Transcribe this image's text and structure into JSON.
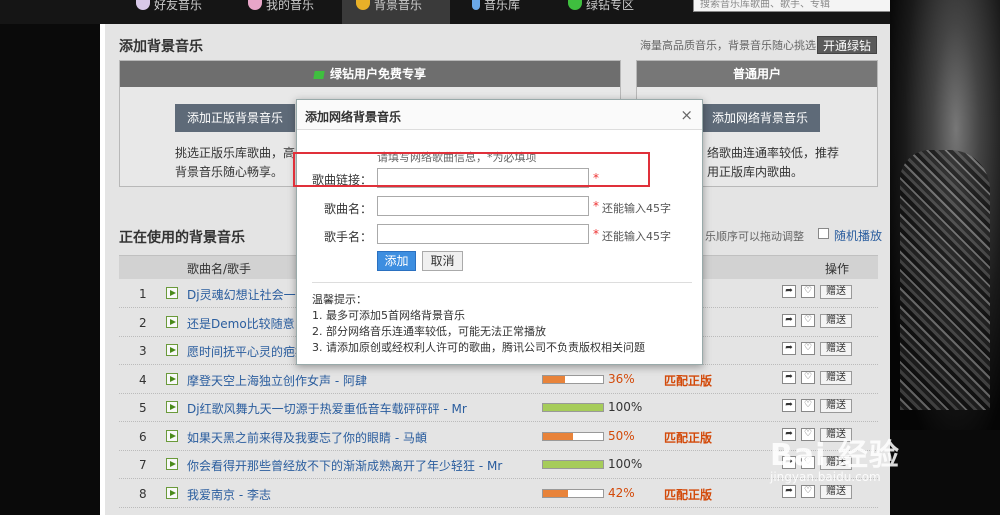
{
  "nav": {
    "items": [
      {
        "label": "好友音乐",
        "icon": "user-icon"
      },
      {
        "label": "我的音乐",
        "icon": "user-icon"
      },
      {
        "label": "背景音乐",
        "icon": "star-icon"
      },
      {
        "label": "音乐库",
        "icon": "note-icon"
      },
      {
        "label": "绿钻专区",
        "icon": "gem-icon"
      }
    ],
    "search_placeholder": "搜索音乐库歌曲、歌手、专辑"
  },
  "add_section": {
    "title": "添加背景音乐",
    "hint": "海量高品质音乐，背景音乐随心挑选",
    "open_button": "开通绿钻",
    "vip_box": {
      "title": "绿钻用户免费专享",
      "button": "添加正版背景音乐",
      "text": "挑选正版乐库歌曲，高品",
      "text2": "背景音乐随心畅享。"
    },
    "normal_box": {
      "title": "普通用户",
      "button": "添加网络背景音乐",
      "text": "络歌曲连通率较低，推荐",
      "text2": "用正版库内歌曲。"
    }
  },
  "using_section": {
    "title": "正在使用的背景音乐",
    "drag_hint": "乐顺序可以拖动调整",
    "random_label": "随机播放",
    "col_song": "歌曲名/歌手",
    "col_action": "操作",
    "send_label": "赠送",
    "rows": [
      {
        "num": "1",
        "name": "Dj灵魂幻想让社会一次",
        "pct": "",
        "match": "",
        "fill": 0,
        "color": "#8cc152"
      },
      {
        "num": "2",
        "name": "还是Demo比较随意 - 先",
        "pct": "",
        "match": "",
        "fill": 0,
        "color": "#8cc152"
      },
      {
        "num": "3",
        "name": "愿时间抚平心灵的疤痕",
        "pct": "",
        "match": "",
        "fill": 0,
        "color": "#8cc152"
      },
      {
        "num": "4",
        "name": "摩登天空上海独立创作女声 - 阿肆",
        "pct": "36%",
        "match": "匹配正版",
        "fill": 0.36,
        "color": "#e8833a"
      },
      {
        "num": "5",
        "name": "Dj红歌风舞九天一切源于热爱重低音车载砰砰砰 - Mr",
        "pct": "100%",
        "match": "",
        "fill": 1,
        "color": "#a6cc5a"
      },
      {
        "num": "6",
        "name": "如果天黑之前来得及我要忘了你的眼睛 - 马頔",
        "pct": "50%",
        "match": "匹配正版",
        "fill": 0.5,
        "color": "#e8833a"
      },
      {
        "num": "7",
        "name": "你会看得开那些曾经放不下的渐渐成熟离开了年少轻狂 - Mr",
        "pct": "100%",
        "match": "",
        "fill": 1,
        "color": "#a6cc5a"
      },
      {
        "num": "8",
        "name": "我爱南京 - 李志",
        "pct": "42%",
        "match": "匹配正版",
        "fill": 0.42,
        "color": "#e8833a"
      }
    ]
  },
  "modal": {
    "title": "添加网络背景音乐",
    "close": "×",
    "note": "请填写网络歌曲信息，*为必填项",
    "link_label": "歌曲链接：",
    "name_label": "歌曲名：",
    "singer_label": "歌手名：",
    "remain_name": "还能输入45字",
    "remain_singer": "还能输入45字",
    "star": "*",
    "add_button": "添加",
    "cancel_button": "取消",
    "tips_title": "温馨提示：",
    "tip1": "1. 最多可添加5首网络背景音乐",
    "tip2": "2. 部分网络音乐连通率较低，可能无法正常播放",
    "tip3": "3. 请添加原创或经权利人许可的歌曲，腾讯公司不负责版权相关问题"
  },
  "watermark": {
    "brand": "Bai 经验",
    "url": "jingyan.baidu.com"
  }
}
